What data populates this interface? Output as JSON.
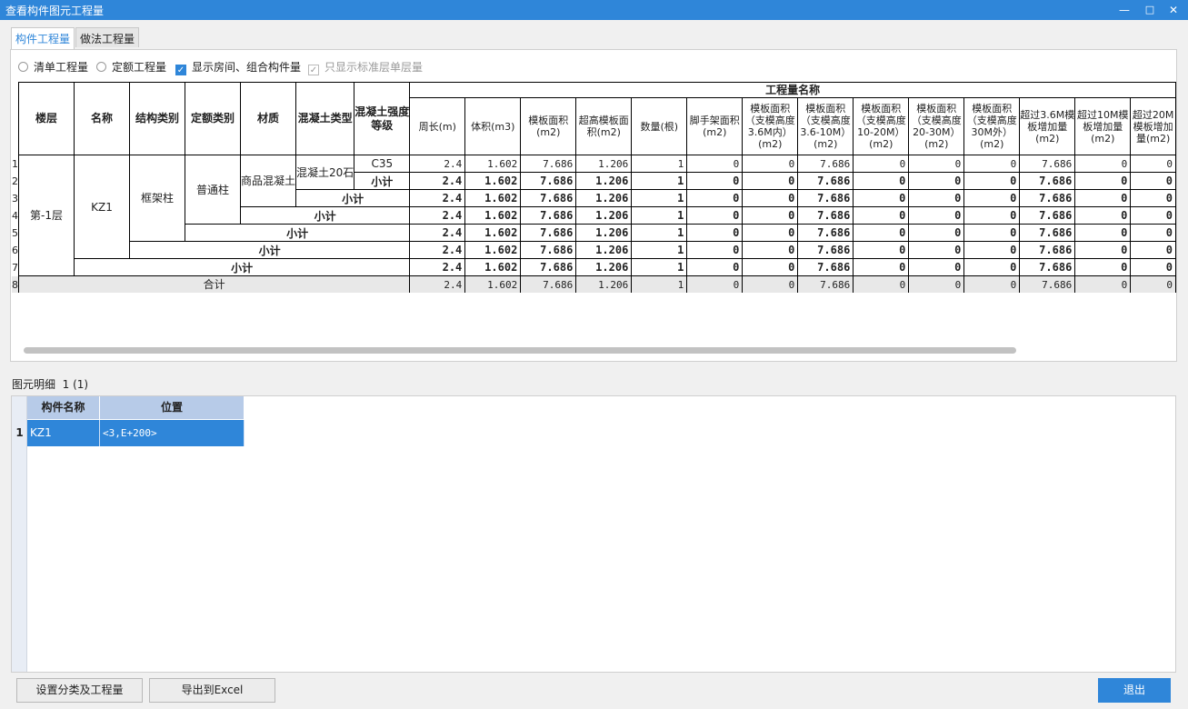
{
  "window": {
    "title": "查看构件图元工程量",
    "min": "—",
    "max": "□",
    "close": "✕"
  },
  "tabs": [
    {
      "label": "构件工程量"
    },
    {
      "label": "做法工程量"
    }
  ],
  "options": {
    "list_qty": "清单工程量",
    "quota_qty": "定额工程量",
    "show_room": "显示房间、组合构件量",
    "std_floor_only": "只显示标准层单层量"
  },
  "grid": {
    "headers": {
      "floor": "楼层",
      "name": "名称",
      "struct": "结构类别",
      "quota": "定额类别",
      "material": "材质",
      "concrete": "混凝土类型",
      "grade": "混凝土强度等级",
      "qty_group": "工程量名称",
      "cols": [
        "周长(m)",
        "体积(m3)",
        "模板面积(m2)",
        "超高模板面积(m2)",
        "数量(根)",
        "脚手架面积(m2)",
        "模板面积（支模高度3.6M内）(m2)",
        "模板面积（支模高度3.6-10M）(m2)",
        "模板面积（支模高度10-20M）(m2)",
        "模板面积（支模高度20-30M）(m2)",
        "模板面积（支模高度30M外）(m2)",
        "超过3.6M模板增加量(m2)",
        "超过10M模板增加量(m2)",
        "超过20M模板增加量(m2)"
      ]
    },
    "row_numbers": [
      "1",
      "2",
      "3",
      "4",
      "5",
      "6",
      "7",
      "8"
    ],
    "cells": {
      "floor": "第-1层",
      "name": "KZ1",
      "struct": "框架柱",
      "quota": "普通柱",
      "material": "商品混凝土",
      "concrete": "混凝土20石",
      "grade": "C35",
      "subtotal": "小计",
      "total": "合计"
    },
    "values": [
      "2.4",
      "1.602",
      "7.686",
      "1.206",
      "1",
      "0",
      "0",
      "7.686",
      "0",
      "0",
      "0",
      "7.686",
      "0",
      "0"
    ]
  },
  "detail": {
    "label": "图元明细",
    "count": "1 (1)",
    "headers": [
      "构件名称",
      "位置"
    ],
    "rows": [
      {
        "no": "1",
        "name": "KZ1",
        "position": "<3,E+200>"
      }
    ]
  },
  "buttons": {
    "set_category": "设置分类及工程量",
    "export_excel": "导出到Excel",
    "exit": "退出"
  }
}
